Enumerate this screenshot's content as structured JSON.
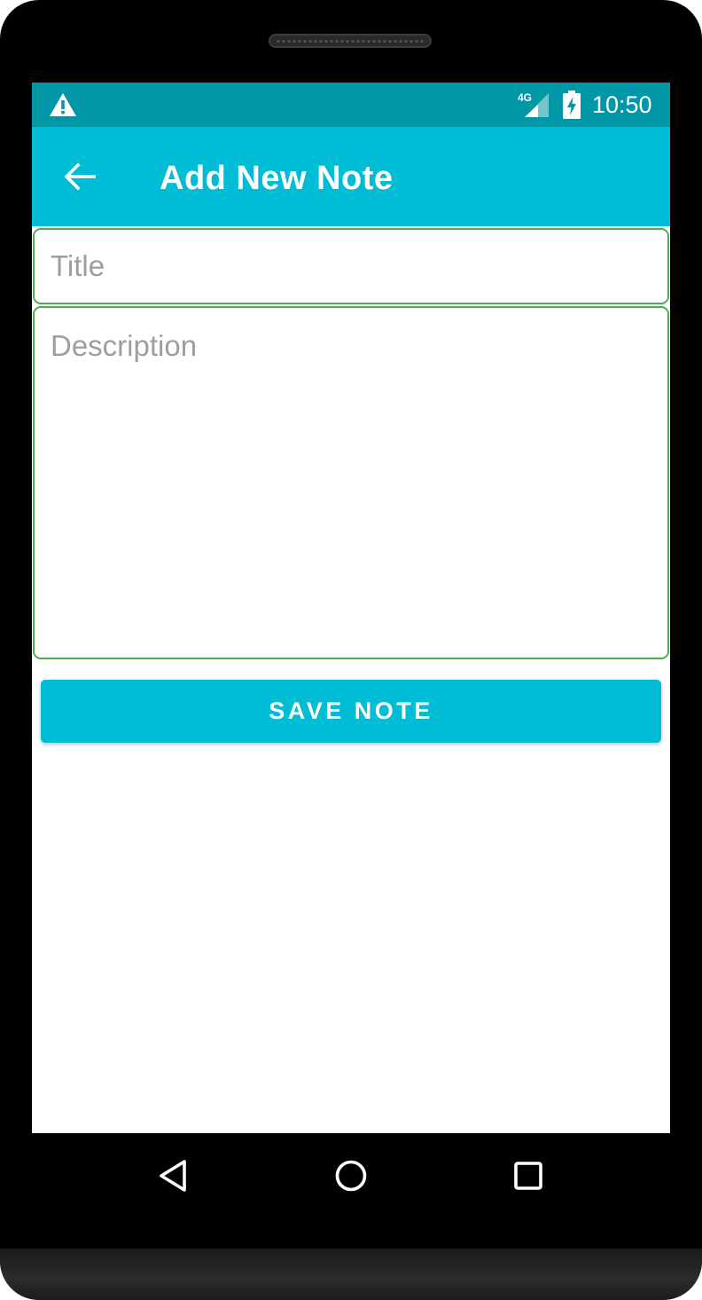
{
  "status_bar": {
    "time": "10:50",
    "network_label": "4G",
    "icons": [
      "warning-icon",
      "signal-4g-icon",
      "battery-charging-icon"
    ]
  },
  "app_bar": {
    "title": "Add New Note",
    "back_icon": "arrow-back-icon"
  },
  "form": {
    "title_field": {
      "value": "",
      "placeholder": "Title"
    },
    "description_field": {
      "value": "",
      "placeholder": "Description"
    },
    "save_label": "SAVE NOTE"
  },
  "nav_bar": {
    "icons": [
      "nav-back-icon",
      "nav-home-icon",
      "nav-recents-icon"
    ]
  },
  "colors": {
    "status_bar": "#0097a7",
    "app_bar": "#00bcd4",
    "button": "#00bcd4",
    "field_border": "#4caf50",
    "placeholder": "#9e9e9e"
  }
}
